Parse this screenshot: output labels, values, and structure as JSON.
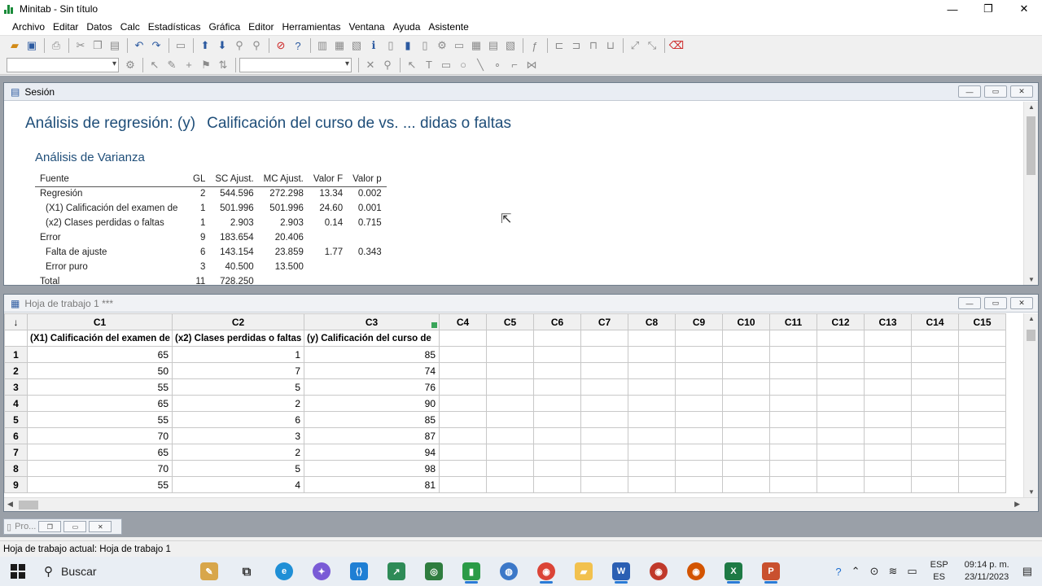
{
  "app": {
    "title": "Minitab - Sin título"
  },
  "window_controls": {
    "minimize": "—",
    "maximize": "❐",
    "close": "✕"
  },
  "menu": [
    "Archivo",
    "Editar",
    "Datos",
    "Calc",
    "Estadísticas",
    "Gráfica",
    "Editor",
    "Herramientas",
    "Ventana",
    "Ayuda",
    "Asistente"
  ],
  "session": {
    "title": "Sesión",
    "heading_part1": "Análisis de regresión: (y)",
    "heading_part2": "Calificación del curso de vs. ... didas o faltas",
    "subheading": "Análisis de Varianza",
    "columns": [
      "Fuente",
      "GL",
      "SC Ajust.",
      "MC Ajust.",
      "Valor F",
      "Valor p"
    ],
    "rows": [
      [
        "Regresión",
        "2",
        "544.596",
        "272.298",
        "13.34",
        "0.002"
      ],
      [
        "(X1) Calificación del examen de",
        "1",
        "501.996",
        "501.996",
        "24.60",
        "0.001"
      ],
      [
        "(x2) Clases perdidas o faltas",
        "1",
        "2.903",
        "2.903",
        "0.14",
        "0.715"
      ],
      [
        "Error",
        "9",
        "183.654",
        "20.406",
        "",
        ""
      ],
      [
        "Falta de ajuste",
        "6",
        "143.154",
        "23.859",
        "1.77",
        "0.343"
      ],
      [
        "Error puro",
        "3",
        "40.500",
        "13.500",
        "",
        ""
      ],
      [
        "Total",
        "11",
        "728.250",
        "",
        "",
        ""
      ]
    ]
  },
  "worksheet": {
    "title": "Hoja de trabajo 1 ***",
    "corner": "↓",
    "columns": [
      "C1",
      "C2",
      "C3",
      "C4",
      "C5",
      "C6",
      "C7",
      "C8",
      "C9",
      "C10",
      "C11",
      "C12",
      "C13",
      "C14",
      "C15"
    ],
    "names": [
      "(X1) Calificación del examen de",
      "(x2) Clases perdidas o faltas",
      "(y)   Calificación del curso de"
    ],
    "rows": [
      [
        "1",
        "65",
        "1",
        "85"
      ],
      [
        "2",
        "50",
        "7",
        "74"
      ],
      [
        "3",
        "55",
        "5",
        "76"
      ],
      [
        "4",
        "65",
        "2",
        "90"
      ],
      [
        "5",
        "55",
        "6",
        "85"
      ],
      [
        "6",
        "70",
        "3",
        "87"
      ],
      [
        "7",
        "65",
        "2",
        "94"
      ],
      [
        "8",
        "70",
        "5",
        "98"
      ],
      [
        "9",
        "55",
        "4",
        "81"
      ]
    ]
  },
  "minimized": {
    "label": "Pro..."
  },
  "status": "Hoja de trabajo actual: Hoja de trabajo 1",
  "taskbar": {
    "search": "Buscar",
    "language": "ESP",
    "language_sub": "ES",
    "time": "09:14 p. m.",
    "date": "23/11/2023"
  }
}
